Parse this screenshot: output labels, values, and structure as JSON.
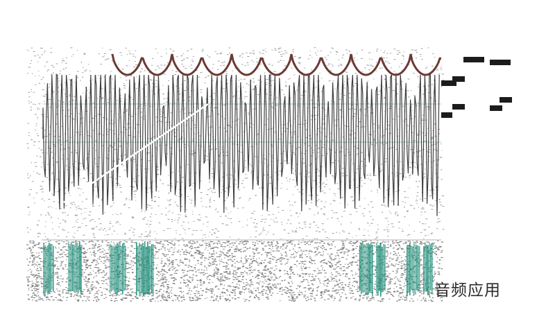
{
  "caption": "音频应用",
  "colors": {
    "background": "#ffffff",
    "waveform": "#1c1c1c",
    "envelope": "#6b3a33",
    "spectrum_bars": "#1f8f7a",
    "noise": "#4a4a4a",
    "guide_line": "#c9ded6",
    "caption_text": "#2a2a2a"
  },
  "icons": [
    "noise-texture",
    "waveform-icon",
    "envelope-curve",
    "spectrum-bars",
    "level-steps"
  ]
}
